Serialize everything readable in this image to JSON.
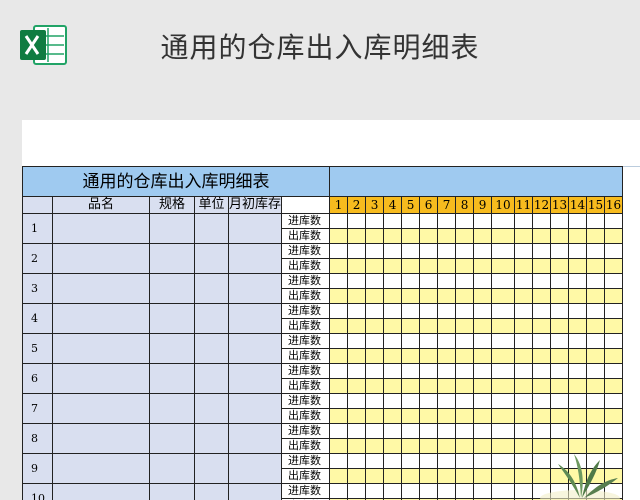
{
  "header": {
    "title": "通用的仓库出入库明细表",
    "app_icon": "excel-icon"
  },
  "sheet": {
    "title": "通用的仓库出入库明细表",
    "columns": [
      "品名",
      "规格",
      "单位",
      "月初库存"
    ],
    "days": [
      "1",
      "2",
      "3",
      "4",
      "5",
      "6",
      "7",
      "8",
      "9",
      "10",
      "11",
      "12",
      "13",
      "14",
      "15",
      "16"
    ],
    "in_label": "进库数",
    "out_label": "出库数",
    "rows": [
      "1",
      "2",
      "3",
      "4",
      "5",
      "6",
      "7",
      "8",
      "9",
      "10"
    ]
  },
  "colors": {
    "title_blue": "#9fcaf0",
    "header_lavender": "#d9dff0",
    "day_orange": "#f7bb1e",
    "out_yellow": "#fff9a6"
  }
}
